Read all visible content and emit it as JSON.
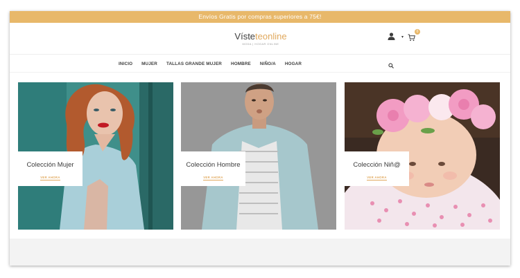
{
  "promo": {
    "text": "Envíos Gratis por compras superiores a 75€!"
  },
  "logo": {
    "part1": "Víste",
    "part2": "teonline",
    "tagline": "MODA  |  HOGAR  ONLINE"
  },
  "header": {
    "cart_count": "0",
    "user_caret": "▾"
  },
  "nav": {
    "items": [
      "INICIO",
      "MUJER",
      "TALLAS GRANDE MUJER",
      "HOMBRE",
      "NIÑO/A",
      "HOGAR"
    ]
  },
  "collections": [
    {
      "title": "Colección Mujer",
      "cta": "VER AHORA"
    },
    {
      "title": "Colección Hombre",
      "cta": "VER AHORA"
    },
    {
      "title": "Colección Niñ@",
      "cta": "VER AHORA"
    }
  ],
  "colors": {
    "accent": "#e8b86a",
    "text": "#3d3d3d",
    "footer": "#f3f3f3"
  },
  "icons": {
    "user": "user-icon",
    "cart": "cart-icon",
    "search": "search-icon"
  }
}
